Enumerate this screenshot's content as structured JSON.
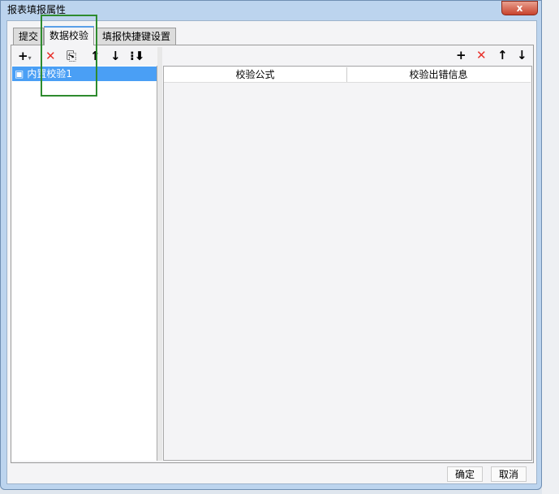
{
  "window": {
    "title": "报表填报属性",
    "close": "x"
  },
  "tabs": [
    {
      "label": "提交"
    },
    {
      "label": "数据校验"
    },
    {
      "label": "填报快捷键设置"
    }
  ],
  "left_list": {
    "items": [
      {
        "label": "内置校验1",
        "selected": true
      }
    ]
  },
  "right_table": {
    "columns": [
      "校验公式",
      "校验出错信息"
    ]
  },
  "footer": {
    "ok": "确定",
    "cancel": "取消"
  },
  "colors": {
    "selection": "#4a9ff5",
    "annotation": "#2e8b2e",
    "delete": "#e8302a"
  }
}
